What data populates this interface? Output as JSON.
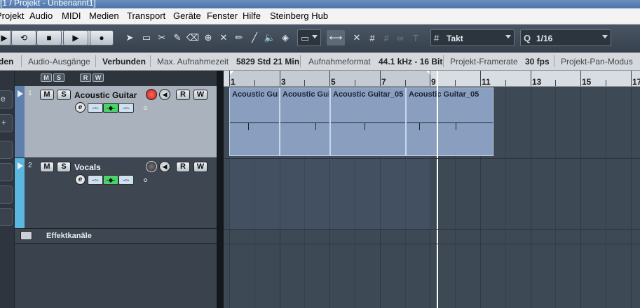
{
  "window": {
    "title": "[1 / Projekt - Unbenannt1]"
  },
  "menubar": {
    "items": [
      "Projekt",
      "Audio",
      "MIDI",
      "Medien",
      "Transport",
      "Geräte",
      "Fenster",
      "Hilfe",
      "Steinberg Hub"
    ]
  },
  "toolbar": {
    "grid_type": "Takt",
    "quantize_prefix": "Q",
    "quantize_value": "1/16"
  },
  "infoline": {
    "items": [
      {
        "text": "den",
        "bold": true
      },
      {
        "text": "Audio-Ausgänge",
        "bold": false
      },
      {
        "text": "Verbunden",
        "bold": true
      },
      {
        "text": "Max. Aufnahmezeit",
        "bold": false
      },
      {
        "text": "5829 Std 21 Min",
        "bold": true
      },
      {
        "text": "Aufnahmeformat",
        "bold": false
      },
      {
        "text": "44.1 kHz - 16 Bit",
        "bold": true
      },
      {
        "text": "Projekt-Framerate",
        "bold": false
      },
      {
        "text": "30 fps",
        "bold": true
      },
      {
        "text": "Projekt-Pan-Modus",
        "bold": false
      }
    ]
  },
  "tracklist": {
    "header_buttons": [
      "M",
      "S",
      "R",
      "W"
    ],
    "tracks": [
      {
        "number": "1",
        "name": "Acoustic Guitar",
        "mute": "M",
        "solo": "S",
        "read": "R",
        "write": "W",
        "edit": "e",
        "color": "#5f80ad",
        "recording": true
      },
      {
        "number": "2",
        "name": "Vocals",
        "mute": "M",
        "solo": "S",
        "read": "R",
        "write": "W",
        "edit": "e",
        "color": "#5bb6e0",
        "recording": false
      }
    ],
    "fx_folder": {
      "name": "Effektkanäle"
    }
  },
  "ruler": {
    "bars": [
      "1",
      "3",
      "5",
      "7",
      "9",
      "11",
      "13",
      "15",
      "17"
    ]
  },
  "events": [
    {
      "label": "Acoustic Gui"
    },
    {
      "label": "Acoustic Gui"
    },
    {
      "label": "Acoustic Guitar_05"
    },
    {
      "label": "Acoustic Guitar_05"
    }
  ],
  "colors": {
    "accent_blue": "#5f80ad",
    "vocals": "#5bb6e0",
    "record_red": "#e0413a",
    "monitor_green": "#4bd36b"
  }
}
